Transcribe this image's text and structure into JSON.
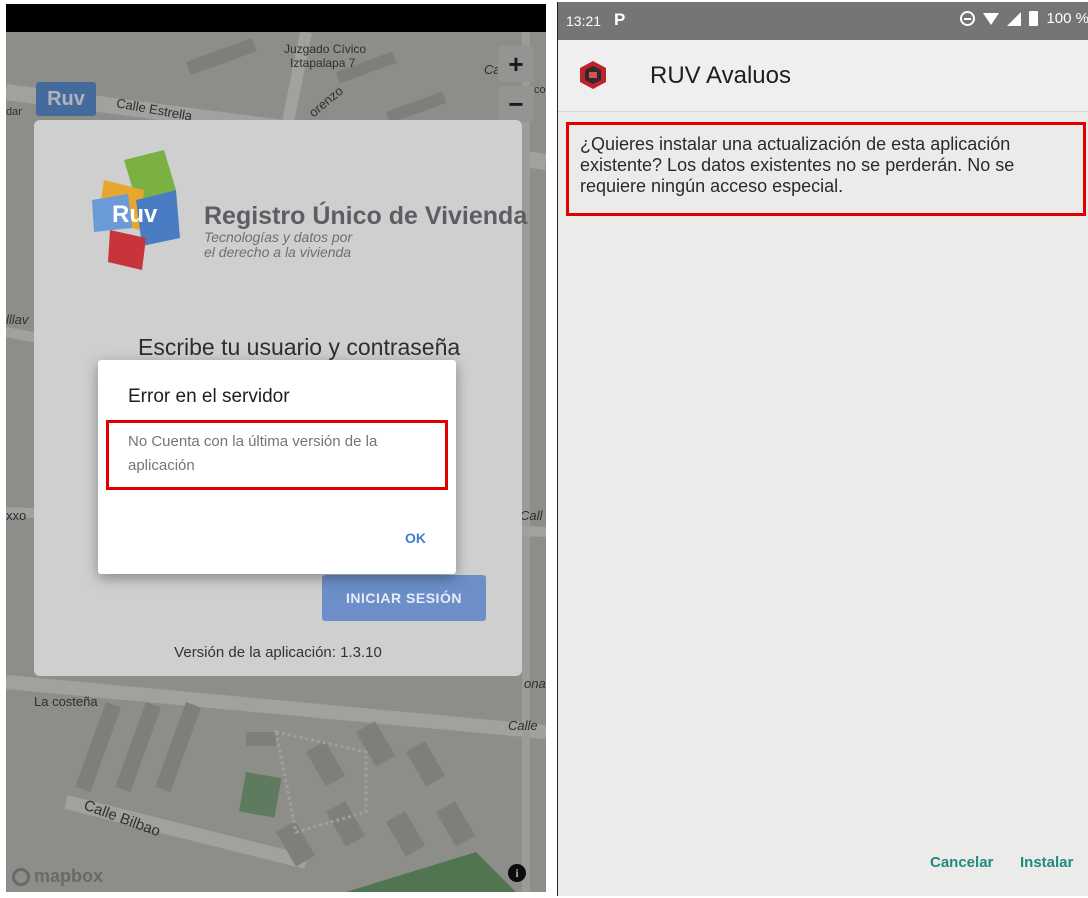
{
  "left_screen": {
    "map": {
      "labels": [
        "Juzgado Cívico",
        "Iztapalapa 7",
        "Calle Estrella",
        "orenzo",
        "lllav",
        "xxo",
        "Call",
        "La costeña",
        "Calle",
        "Calle Bilbao",
        "Ca",
        "co",
        "ona",
        "dar"
      ],
      "zoom_in_label": "+",
      "zoom_out_label": "−",
      "attribution": "mapbox",
      "info_label": "i"
    },
    "login": {
      "logo_text": "Ruv",
      "brand_title": "Registro Único de Vivienda",
      "brand_subtitle_line1": "Tecnologías y datos por",
      "brand_subtitle_line2": "el derecho a la vivienda",
      "heading": "Escribe tu usuario y contraseña",
      "login_button": "INICIAR SESIÓN",
      "app_version": "Versión de la aplicación: 1.3.10"
    },
    "dialog": {
      "title": "Error en el servidor",
      "message": "No Cuenta con la última versión de la aplicación",
      "ok_button": "OK"
    },
    "map_logo_small": "Ruv"
  },
  "right_screen": {
    "status_bar": {
      "time": "13:21",
      "notification_icon": "P",
      "battery": "100 %"
    },
    "app_title": "RUV Avaluos",
    "install_message": "¿Quieres instalar una actualización de esta aplicación existente? Los datos existentes no se perderán. No se requiere ningún acceso especial.",
    "cancel_button": "Cancelar",
    "install_button": "Instalar"
  },
  "colors": {
    "highlight_red": "#e00000",
    "android_teal": "#1f8a80",
    "dialog_ok_blue": "#3f7cd6",
    "login_button_blue": "#6c8fc9"
  }
}
